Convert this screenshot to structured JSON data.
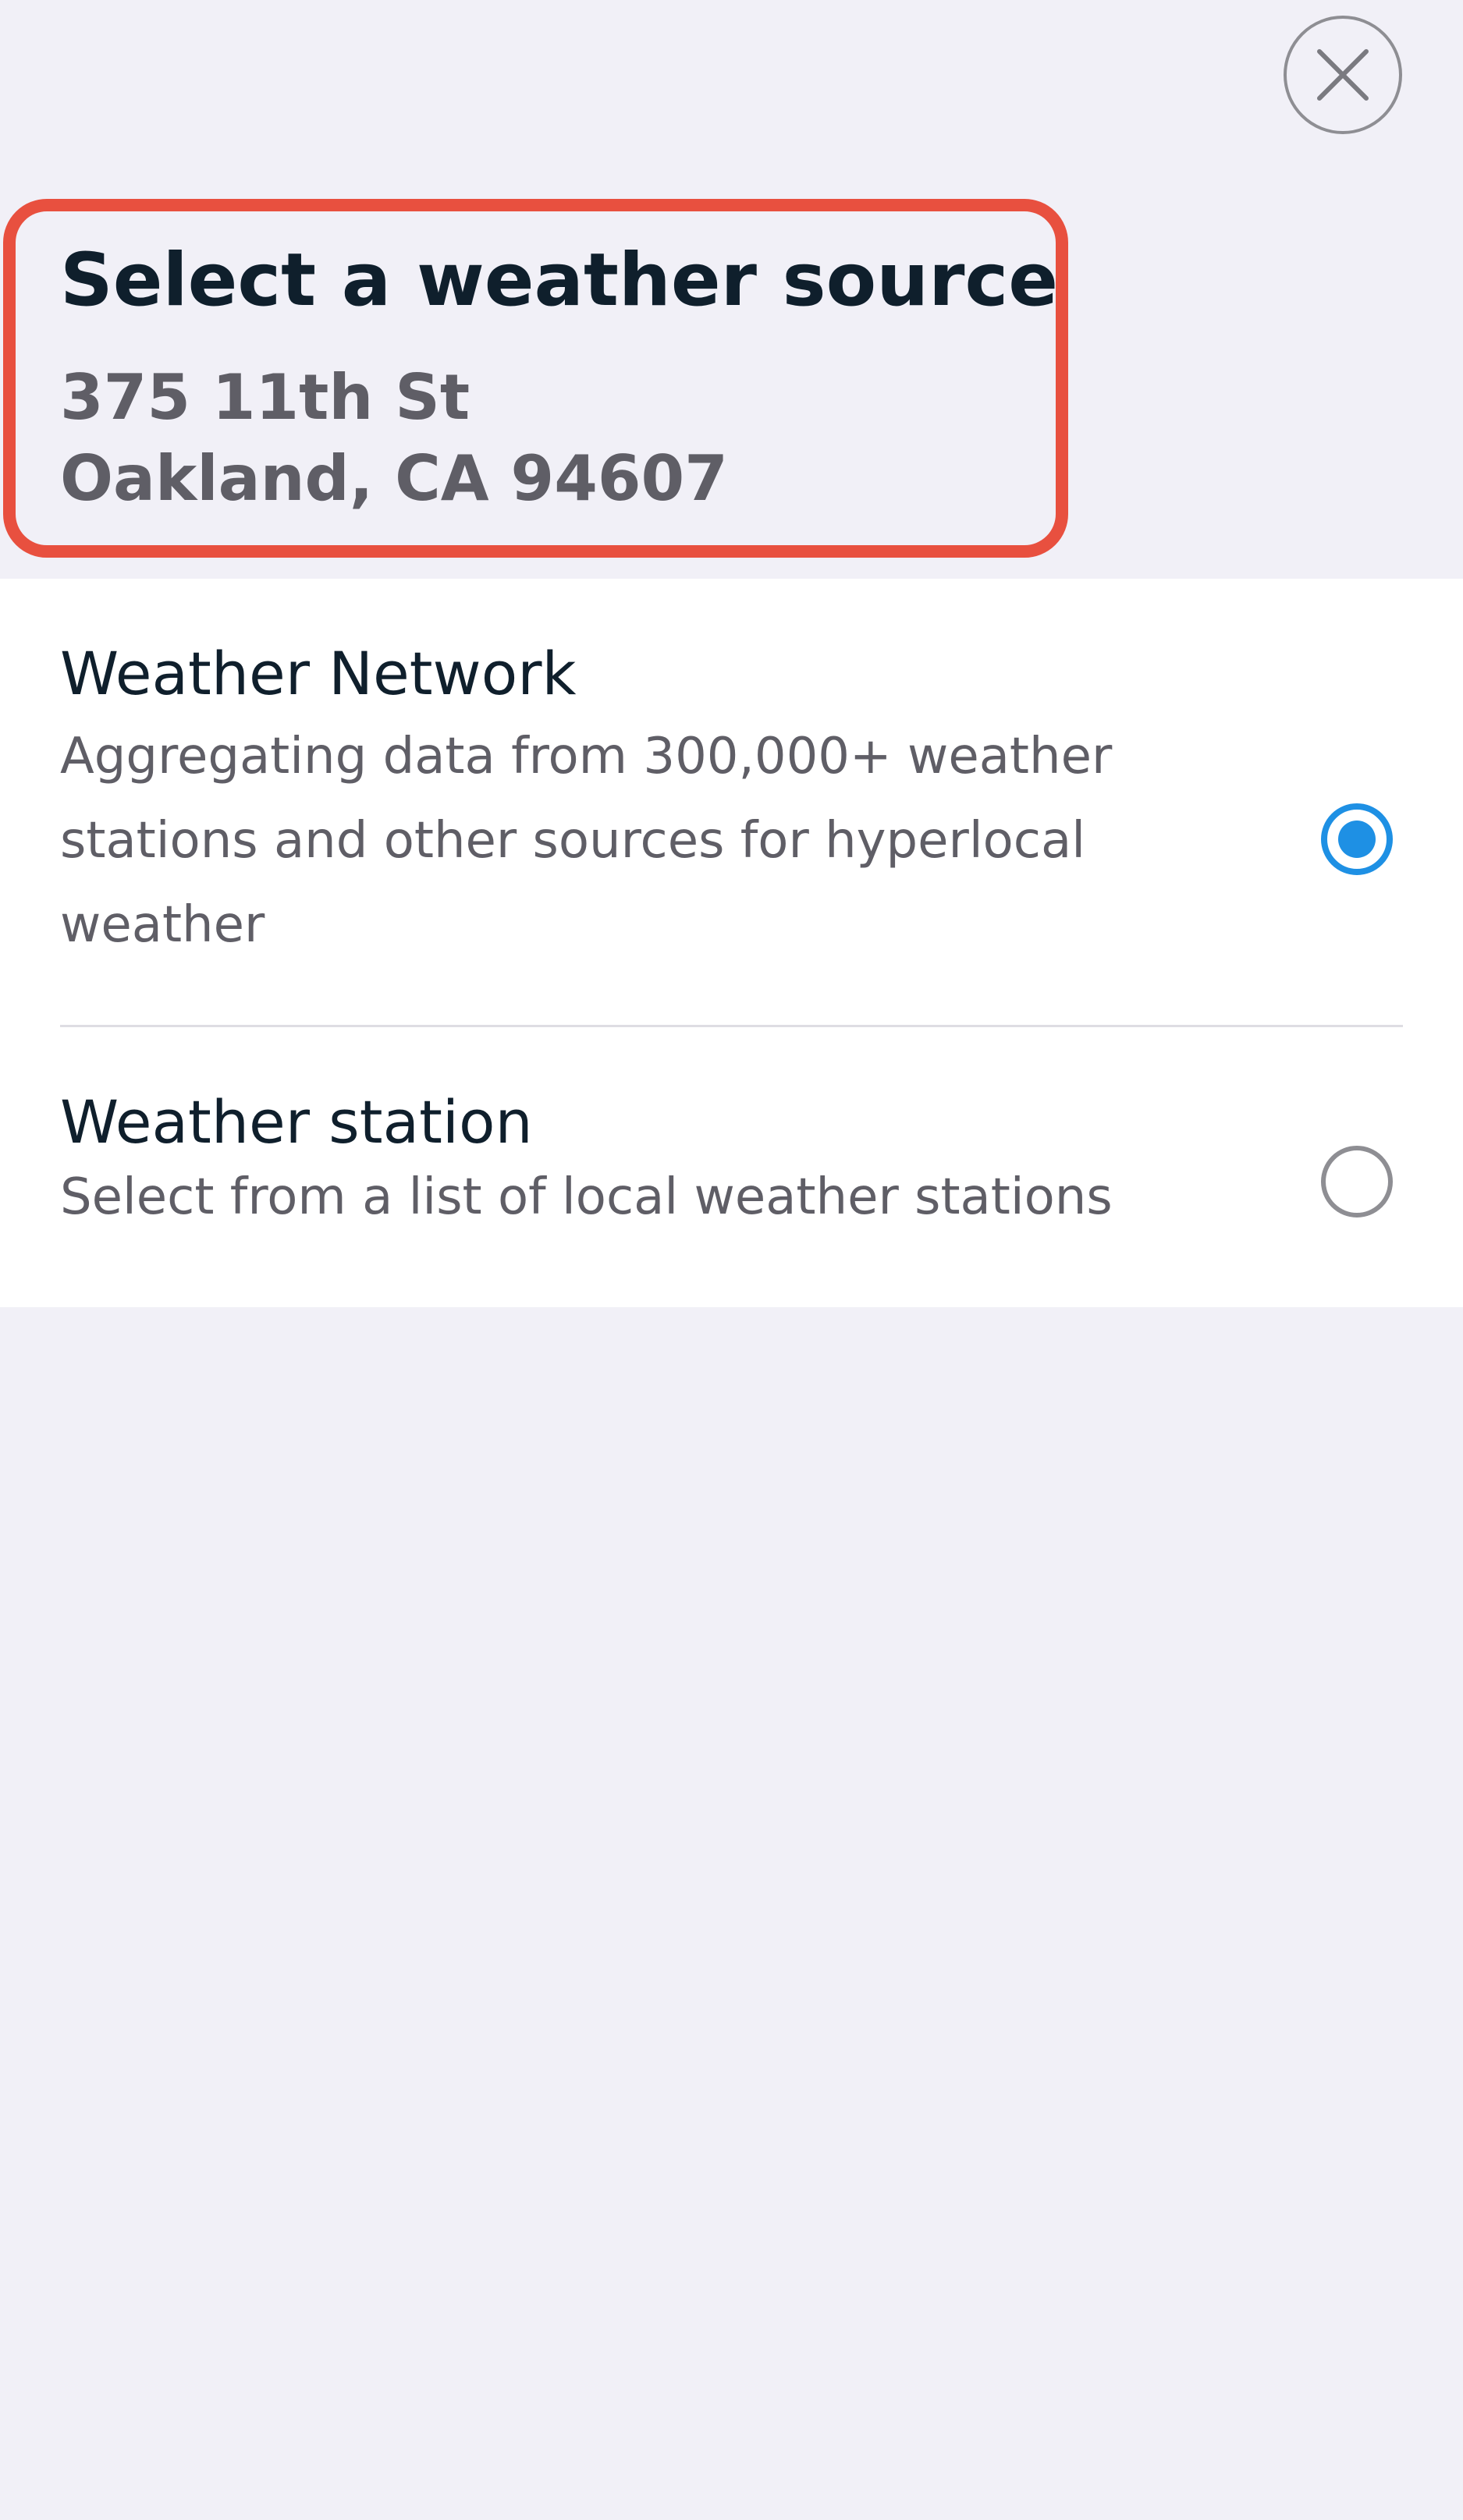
{
  "header": {
    "title": "Select a weather source",
    "address_line1": "375 11th St",
    "address_line2": "Oakland, CA 94607",
    "highlight_color": "#e8503f"
  },
  "close_icon": "close-icon",
  "options": [
    {
      "title": "Weather Network",
      "description": "Aggregating data from 300,000+ weather stations and other sources for hyperlocal weather",
      "selected": true
    },
    {
      "title": "Weather station",
      "description": "Select from a list of local weather stations",
      "selected": false
    }
  ],
  "colors": {
    "accent": "#1e90e4",
    "background": "#f1f0f7",
    "panel": "#ffffff",
    "title_text": "#0f1f2c",
    "secondary_text": "#5f5e66"
  }
}
